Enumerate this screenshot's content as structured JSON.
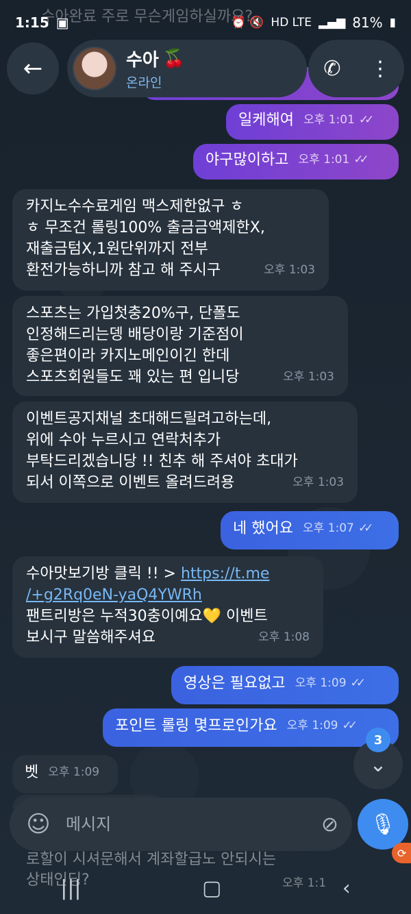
{
  "status_bar": {
    "time": "1:15",
    "network": "HD LTE",
    "battery": "81%"
  },
  "ghost_top_text": "수아완료 주로 무슨게임하실까요?",
  "header": {
    "name": "수아",
    "name_emoji": "🍒",
    "status": "온라인"
  },
  "messages": {
    "m1": {
      "text": "일케해여",
      "time": "오후 1:01",
      "ticks": "✓✓"
    },
    "m2": {
      "text": "야구많이하고",
      "time": "오후 1:01",
      "ticks": "✓✓"
    },
    "m3": {
      "line1": "카지노수수료게임 맥스제한없구 ㅎ",
      "line2": "ㅎ 무조건 롤링100% 출금금액제한X,",
      "line3": "재출금텀X,1원단위까지 전부",
      "line4": "환전가능하니까 참고 해 주시구",
      "time": "오후 1:03"
    },
    "m4": {
      "line1": "스포츠는 가입첫충20%구,  단폴도",
      "line2": "인정해드리는뎅 배당이랑 기준점이",
      "line3": "좋은편이라 카지노메인이긴 한데",
      "line4": "스포츠회원들도 꽤 있는 편 입니당",
      "time": "오후 1:03"
    },
    "m5": {
      "line1": "이벤트공지채널 초대해드릴려고하는데,",
      "line2": "위에 수아 누르시고 연락처추가",
      "line3": "부탁드리겠습니당 !!  친추 해 주셔야 초대가",
      "line4": "되서 이쪽으로 이벤트 올려드려용",
      "time": "오후 1:03"
    },
    "m6": {
      "text": "네 했어요",
      "time": "오후 1:07",
      "ticks": "✓✓"
    },
    "m7": {
      "prefix": "수아맛보기방 클릭 !! > ",
      "link1": "https://t.me",
      "link2": "/+g2Rq0eN-yaQ4YWRh",
      "line3": "팬트리방은 누적30충이예요💛 이벤트",
      "line4": "보시구 말씀해주셔요",
      "time": "오후 1:08"
    },
    "m8": {
      "text": "영상은 필요없고",
      "time": "오후 1:09",
      "ticks": "✓✓"
    },
    "m9": {
      "text": "포인트 롤링 몇프로인가요",
      "time": "오후 1:09",
      "ticks": "✓✓"
    },
    "m10": {
      "text": "벳",
      "time": "오후 1:09"
    }
  },
  "peek_text": {
    "line1": "로할이 시셔문해서 계좌할급노 안되시는",
    "line2": "상태인딩?",
    "time": "오후 1:1"
  },
  "unread_badge": "3",
  "input": {
    "placeholder": "메시지"
  }
}
